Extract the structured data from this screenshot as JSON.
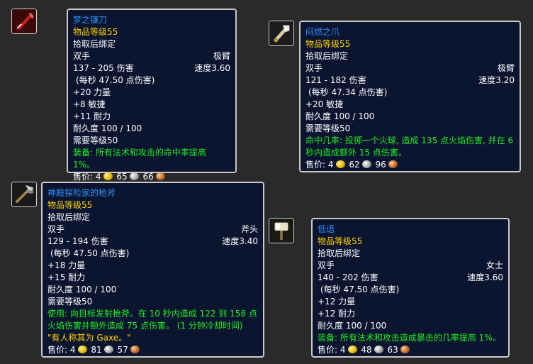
{
  "items": [
    {
      "name": "梦之镰刀",
      "item_level": "物品等级55",
      "bind": "拾取后绑定",
      "hand": "双手",
      "slot_type": "极臂",
      "damage": "137 - 205 伤害",
      "speed": "速度3.60",
      "dps": "(每秒 47.50 点伤害)",
      "stats": [
        "+20 力量",
        "+8 敏捷",
        "+11 耐力"
      ],
      "durability": "耐久度 100 / 100",
      "req_level": "需要等级50",
      "effect": "装备: 所有法术和攻击的命中率提高 1%。",
      "sell_label": "售价:",
      "gold": "4",
      "silver": "65",
      "copper": "66",
      "icon": "red-scythe-icon"
    },
    {
      "name": "闷燃之爪",
      "item_level": "物品等级55",
      "bind": "拾取后绑定",
      "hand": "双手",
      "slot_type": "极臂",
      "damage": "121 - 182 伤害",
      "speed": "速度3.20",
      "dps": "(每秒 47.34 点伤害)",
      "stats": [
        "+20 敏捷"
      ],
      "durability": "耐久度 100 / 100",
      "req_level": "需要等级50",
      "effect": "命中几率: 投掷一个火球, 造成 135 点火焰伤害, 并在 6 秒内造成额外 15 点伤害。",
      "sell_label": "售价:",
      "gold": "4",
      "silver": "62",
      "copper": "96",
      "icon": "claw-polearm-icon"
    },
    {
      "name": "神殿探险家的枪斧",
      "item_level": "物品等级55",
      "bind": "拾取后绑定",
      "hand": "双手",
      "slot_type": "斧头",
      "damage": "129 - 194 伤害",
      "speed": "速度3.40",
      "dps": "(每秒 47.50 点伤害)",
      "stats": [
        "+18 力量",
        "+15 耐力"
      ],
      "durability": "耐久度 100 / 100",
      "req_level": "需要等级50",
      "effect": "使用: 向目标发射枪斧。在 10 秒内造成 122 到 158 点火焰伤害并额外造成 75 点伤害。 (1 分钟冷却时间)",
      "flavor": "\"有人称其为 Gaxe。\"",
      "sell_label": "售价:",
      "gold": "4",
      "silver": "81",
      "copper": "57",
      "icon": "gun-axe-icon"
    },
    {
      "name": "低语",
      "item_level": "物品等级55",
      "bind": "拾取后绑定",
      "hand": "双手",
      "slot_type": "女士",
      "damage": "140 - 202 伤害",
      "speed": "速度3.60",
      "dps": "(每秒 47.50 点伤害)",
      "stats": [
        "+12 力量",
        "+12 耐力"
      ],
      "durability": "耐久度 100 / 100",
      "effect": "装备: 所有法术和攻击造成暴击的几率提高 1%。",
      "sell_label": "售价:",
      "gold": "4",
      "silver": "48",
      "copper": "63",
      "icon": "hammer-icon"
    }
  ]
}
